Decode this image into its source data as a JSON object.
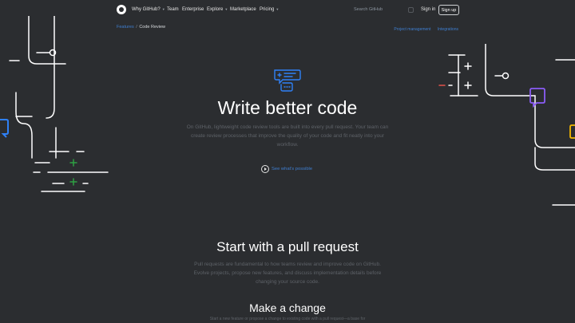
{
  "nav": {
    "items": [
      {
        "label": "Why GitHub?",
        "has_caret": true
      },
      {
        "label": "Team",
        "has_caret": false
      },
      {
        "label": "Enterprise",
        "has_caret": false
      },
      {
        "label": "Explore",
        "has_caret": true
      },
      {
        "label": "Marketplace",
        "has_caret": false
      },
      {
        "label": "Pricing",
        "has_caret": true
      }
    ],
    "search_placeholder": "Search GitHub",
    "search_shortcut": "/",
    "signin": "Sign in",
    "signup": "Sign up"
  },
  "breadcrumb": {
    "parent": "Features",
    "separator": "/",
    "current": "Code Review"
  },
  "sublinks": [
    "Project management",
    "Integrations"
  ],
  "hero": {
    "title": "Write better code",
    "description": "On GitHub, lightweight code review tools are built into every pull request. Your team can create review processes that improve the quality of your code and fit neatly into your workflow.",
    "cta": "See what's possible"
  },
  "section": {
    "title": "Start with a pull request",
    "description": "Pull requests are fundamental to how teams review and improve code on GitHub. Evolve projects, propose new features, and discuss implementation details before changing your source code."
  },
  "subsection": {
    "title": "Make a change",
    "description": "Start a new feature or propose a change to existing code with a pull request—a base for"
  },
  "colors": {
    "background": "#2b2d30",
    "link": "#3f7fd1",
    "green": "#2ea043",
    "red": "#e5534b",
    "purple": "#8b5cf6",
    "yellow": "#f2b600",
    "blue": "#2f81f7"
  }
}
